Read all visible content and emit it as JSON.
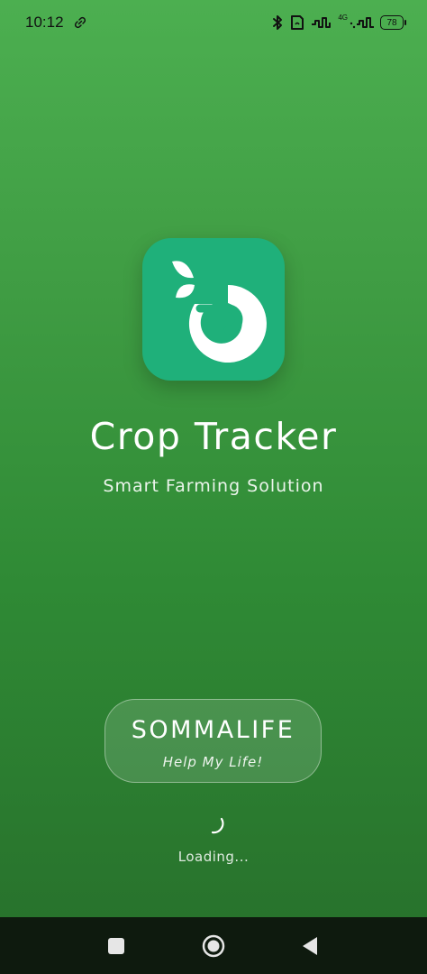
{
  "status_bar": {
    "time": "10:12",
    "network_label": "4G",
    "battery": "78",
    "icons": [
      "link-icon",
      "bluetooth-icon",
      "nfc-icon",
      "signal-icon",
      "signal-4g-icon",
      "battery-icon"
    ]
  },
  "app": {
    "name": "Crop Tracker",
    "subtitle": "Smart Farming Solution",
    "logo_icon": "crop-tracker-logo-icon",
    "logo_color": "#1fb07a"
  },
  "brand": {
    "name": "SOMMALIFE",
    "tagline": "Help My Life!"
  },
  "loading": {
    "text": "Loading..."
  },
  "colors": {
    "background_top": "#4CAF50",
    "background_bottom": "#276f2b",
    "nav_bar": "#0e1a0e"
  },
  "nav": {
    "icons": [
      "recents-icon",
      "home-icon",
      "back-icon"
    ]
  }
}
